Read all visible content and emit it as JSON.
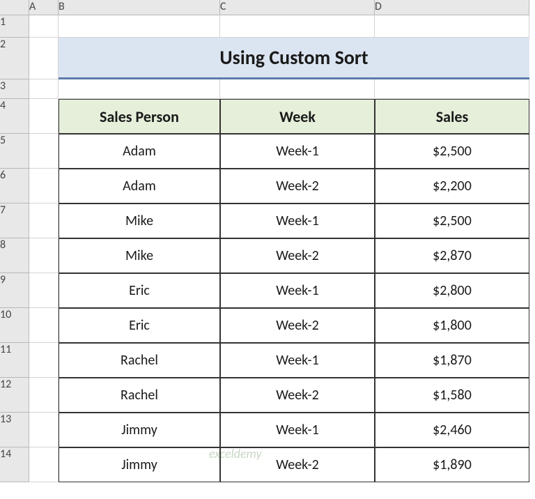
{
  "columns": [
    "",
    "A",
    "B",
    "C",
    "D"
  ],
  "rows": [
    "1",
    "2",
    "3",
    "4",
    "5",
    "6",
    "7",
    "8",
    "9",
    "10",
    "11",
    "12",
    "13",
    "14"
  ],
  "title": "Using Custom Sort",
  "headers": {
    "person": "Sales Person",
    "week": "Week",
    "sales": "Sales"
  },
  "data": [
    {
      "person": "Adam",
      "week": "Week-1",
      "sales": "$2,500"
    },
    {
      "person": "Adam",
      "week": "Week-2",
      "sales": "$2,200"
    },
    {
      "person": "Mike",
      "week": "Week-1",
      "sales": "$2,500"
    },
    {
      "person": "Mike",
      "week": "Week-2",
      "sales": "$2,870"
    },
    {
      "person": "Eric",
      "week": "Week-1",
      "sales": "$2,800"
    },
    {
      "person": "Eric",
      "week": "Week-2",
      "sales": "$1,800"
    },
    {
      "person": "Rachel",
      "week": "Week-1",
      "sales": "$1,870"
    },
    {
      "person": "Rachel",
      "week": "Week-2",
      "sales": "$1,580"
    },
    {
      "person": "Jimmy",
      "week": "Week-1",
      "sales": "$2,460"
    },
    {
      "person": "Jimmy",
      "week": "Week-2",
      "sales": "$1,890"
    }
  ],
  "watermark": "exceldemy",
  "chart_data": {
    "type": "table",
    "title": "Using Custom Sort",
    "columns": [
      "Sales Person",
      "Week",
      "Sales"
    ],
    "rows": [
      [
        "Adam",
        "Week-1",
        2500
      ],
      [
        "Adam",
        "Week-2",
        2200
      ],
      [
        "Mike",
        "Week-1",
        2500
      ],
      [
        "Mike",
        "Week-2",
        2870
      ],
      [
        "Eric",
        "Week-1",
        2800
      ],
      [
        "Eric",
        "Week-2",
        1800
      ],
      [
        "Rachel",
        "Week-1",
        1870
      ],
      [
        "Rachel",
        "Week-2",
        1580
      ],
      [
        "Jimmy",
        "Week-1",
        2460
      ],
      [
        "Jimmy",
        "Week-2",
        1890
      ]
    ]
  }
}
